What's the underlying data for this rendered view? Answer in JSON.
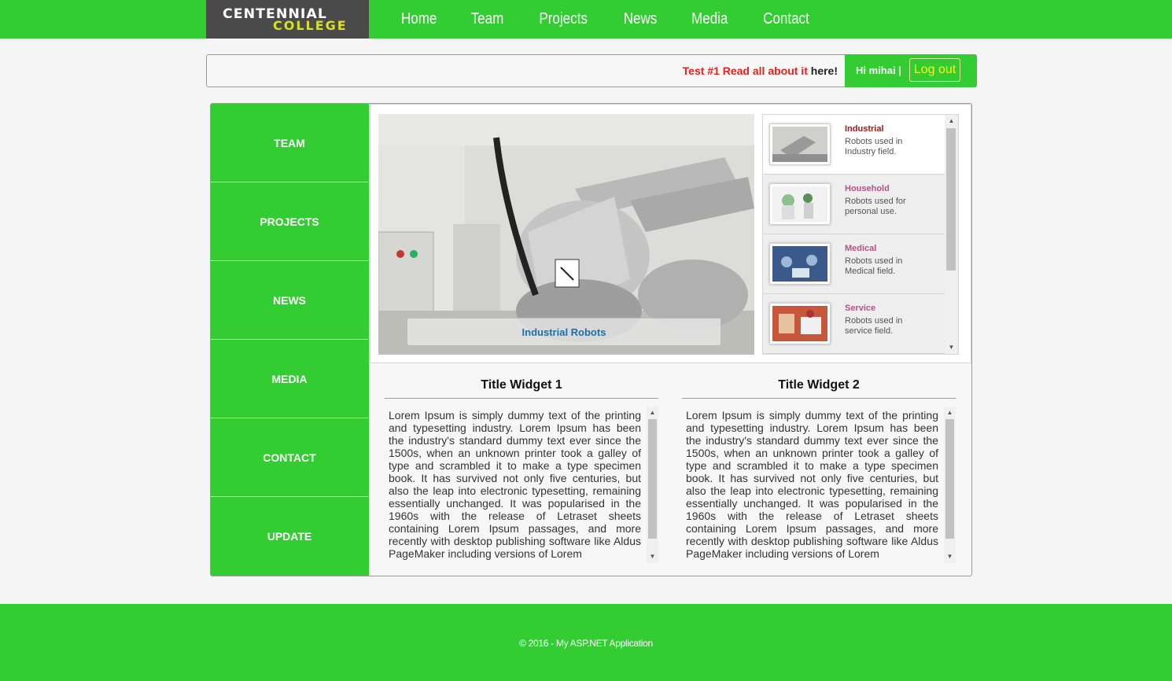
{
  "logo": {
    "line1": "CENTENNIAL",
    "line2": "COLLEGE"
  },
  "nav": {
    "items": [
      "Home",
      "Team",
      "Projects",
      "News",
      "Media",
      "Contact"
    ]
  },
  "notice": {
    "red_text": "Test #1 Read all about it",
    "dark_text": "here!"
  },
  "user": {
    "greeting": "Hi mihai |",
    "logout_label": "Log out"
  },
  "sidebar": {
    "items": [
      "TEAM",
      "PROJECTS",
      "NEWS",
      "MEDIA",
      "CONTACT",
      "UPDATE"
    ]
  },
  "slider": {
    "caption": "Industrial Robots",
    "thumbs": [
      {
        "title": "Industrial",
        "desc": "Robots used in Industry field."
      },
      {
        "title": "Household",
        "desc": "Robots used for personal use."
      },
      {
        "title": "Medical",
        "desc": "Robots used in Medical field."
      },
      {
        "title": "Service",
        "desc": "Robots used in service field."
      }
    ]
  },
  "widgets": [
    {
      "title": "Title Widget 1",
      "text": "Lorem Ipsum is simply dummy text of the printing and typesetting industry. Lorem Ipsum has been the industry's standard dummy text ever since the 1500s, when an unknown printer took a galley of type and scrambled it to make a type specimen book. It has survived not only five centuries, but also the leap into electronic typesetting, remaining essentially unchanged. It was popularised in the 1960s with the release of Letraset sheets containing Lorem Ipsum passages, and more recently with desktop publishing software like Aldus PageMaker including versions of Lorem"
    },
    {
      "title": "Title Widget 2",
      "text": "Lorem Ipsum is simply dummy text of the printing and typesetting industry. Lorem Ipsum has been the industry's standard dummy text ever since the 1500s, when an unknown printer took a galley of type and scrambled it to make a type specimen book. It has survived not only five centuries, but also the leap into electronic typesetting, remaining essentially unchanged. It was popularised in the 1960s with the release of Letraset sheets containing Lorem Ipsum passages, and more recently with desktop publishing software like Aldus PageMaker including versions of Lorem"
    }
  ],
  "footer": {
    "copyright": "© 2016 - My ASP.NET Application"
  },
  "colors": {
    "brand_green": "#33cc33",
    "logo_dark": "#4a4a4a",
    "logo_yellow": "#d9e021",
    "notice_red": "#e5231c",
    "caption_blue": "#1f6fa8"
  }
}
